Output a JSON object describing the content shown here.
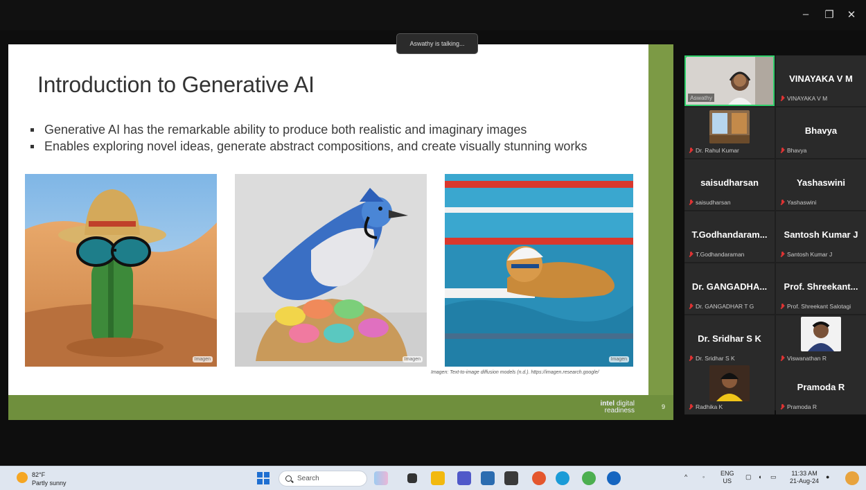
{
  "window": {
    "minimize": "–",
    "restore": "❐",
    "close": "✕"
  },
  "toast": "Aswathy is talking...",
  "slide": {
    "title": "Introduction to Generative AI",
    "bullets": [
      "Generative AI has the remarkable ability to produce both realistic and imaginary images",
      "Enables exploring novel ideas, generate abstract compositions, and create visually stunning works"
    ],
    "image_tag": "Imagen",
    "caption": "Imagen: Text-to-image diffusion models (n.d.). https://imagen.research.google/",
    "footer_brand_bold": "intel",
    "footer_brand_1": "digital",
    "footer_brand_2": "readiness",
    "page_number": "9"
  },
  "participants": [
    {
      "name": "",
      "label": "Aswathy",
      "video": true
    },
    {
      "name": "VINAYAKA V M",
      "label": "VINAYAKA V M"
    },
    {
      "name": "",
      "label": "Dr. Rahul Kumar",
      "video": true
    },
    {
      "name": "Bhavya",
      "label": "Bhavya"
    },
    {
      "name": "saisudharsan",
      "label": "saisudharsan"
    },
    {
      "name": "Yashaswini",
      "label": "Yashaswini"
    },
    {
      "name": "T.Godhandaram...",
      "label": "T.Godhandaraman"
    },
    {
      "name": "Santosh Kumar J",
      "label": "Santosh Kumar J"
    },
    {
      "name": "Dr. GANGADHA...",
      "label": "Dr. GANGADHAR T G"
    },
    {
      "name": "Prof. Shreekant...",
      "label": "Prof. Shreekant Salotagi"
    },
    {
      "name": "Dr. Sridhar S K",
      "label": "Dr. Sridhar S K"
    },
    {
      "name": "",
      "label": "Viswanathan R",
      "video": true
    },
    {
      "name": "",
      "label": "Radhika K",
      "video": true
    },
    {
      "name": "Pramoda R",
      "label": "Pramoda R"
    }
  ],
  "taskbar": {
    "weather_temp": "82°F",
    "weather_desc": "Partly sunny",
    "search_placeholder": "Search",
    "lang_1": "ENG",
    "lang_2": "US",
    "time": "11:33 AM",
    "date": "21-Aug-24"
  },
  "colors": {
    "slide_accent": "#6f8f3d",
    "active_speaker": "#2fd06b",
    "muted_mic": "#d33333"
  }
}
